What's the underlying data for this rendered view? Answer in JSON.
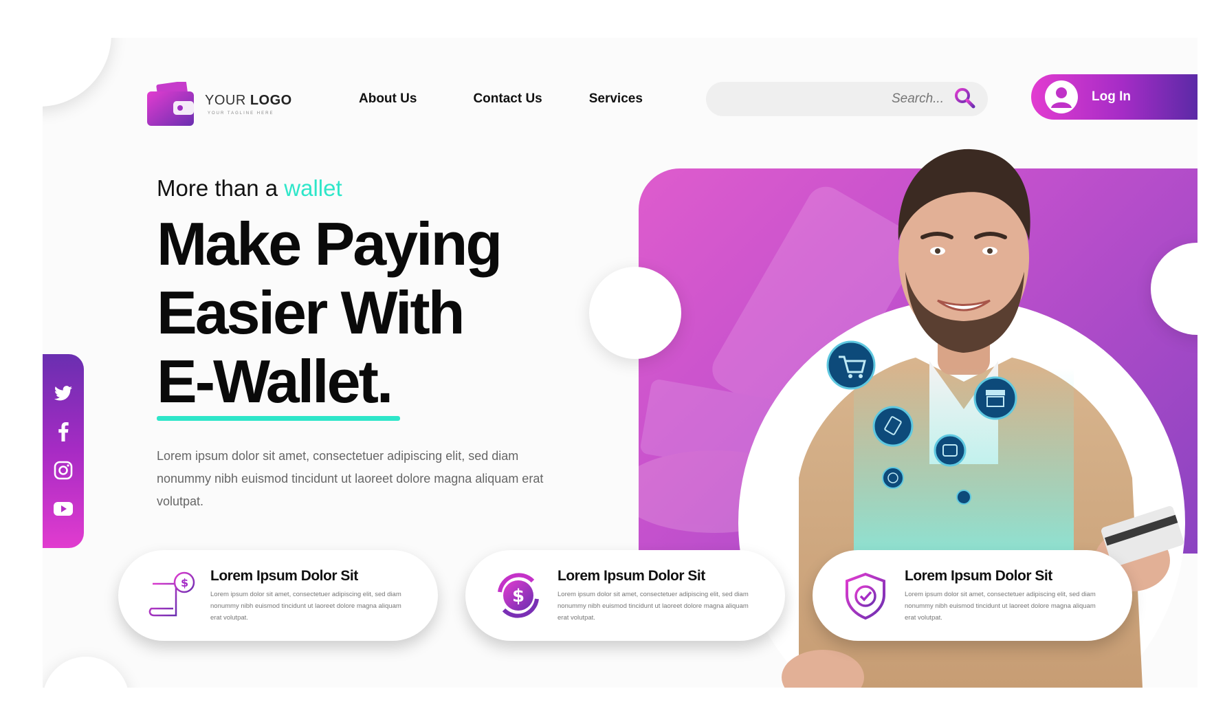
{
  "brand": {
    "logo_text_light": "YOUR ",
    "logo_text_bold": "LOGO",
    "tagline": "YOUR TAGLINE HERE"
  },
  "nav": {
    "items": [
      {
        "label": "About Us"
      },
      {
        "label": "Contact Us"
      },
      {
        "label": "Services"
      }
    ]
  },
  "search": {
    "placeholder": "Search..."
  },
  "login": {
    "label": "Log In"
  },
  "hero": {
    "tagline_prefix": "More than a ",
    "tagline_accent": "wallet",
    "headline_lines": [
      "Make Paying",
      "Easier With",
      "E-Wallet."
    ],
    "description": "Lorem ipsum dolor sit amet, consectetuer adipiscing elit, sed diam nonummy nibh euismod tincidunt ut laoreet dolore magna aliquam erat volutpat."
  },
  "social": {
    "icons": [
      "twitter-icon",
      "facebook-icon",
      "instagram-icon",
      "youtube-icon"
    ]
  },
  "features": [
    {
      "icon": "invoice-dollar-icon",
      "title": "Lorem Ipsum Dolor Sit",
      "text": "Lorem ipsum dolor sit amet, consectetuer adipiscing elit, sed diam nonummy nibh euismod tincidunt ut laoreet dolore magna aliquam erat volutpat."
    },
    {
      "icon": "dollar-exchange-icon",
      "title": "Lorem Ipsum Dolor Sit",
      "text": "Lorem ipsum dolor sit amet, consectetuer adipiscing elit, sed diam nonummy nibh euismod tincidunt ut laoreet dolore magna aliquam erat volutpat."
    },
    {
      "icon": "shield-check-icon",
      "title": "Lorem Ipsum Dolor Sit",
      "text": "Lorem ipsum dolor sit amet, consectetuer adipiscing elit, sed diam nonummy nibh euismod tincidunt ut laoreet dolore magna aliquam erat volutpat."
    }
  ],
  "floating_icons": [
    "cart-icon",
    "store-icon",
    "tag-icon",
    "wallet-icon",
    "globe-icon",
    "trash-icon"
  ],
  "colors": {
    "accent_teal": "#2ee6c9",
    "magenta": "#e13ccf",
    "purple": "#6a2fb0",
    "icon_navy": "#0d4a7a"
  }
}
